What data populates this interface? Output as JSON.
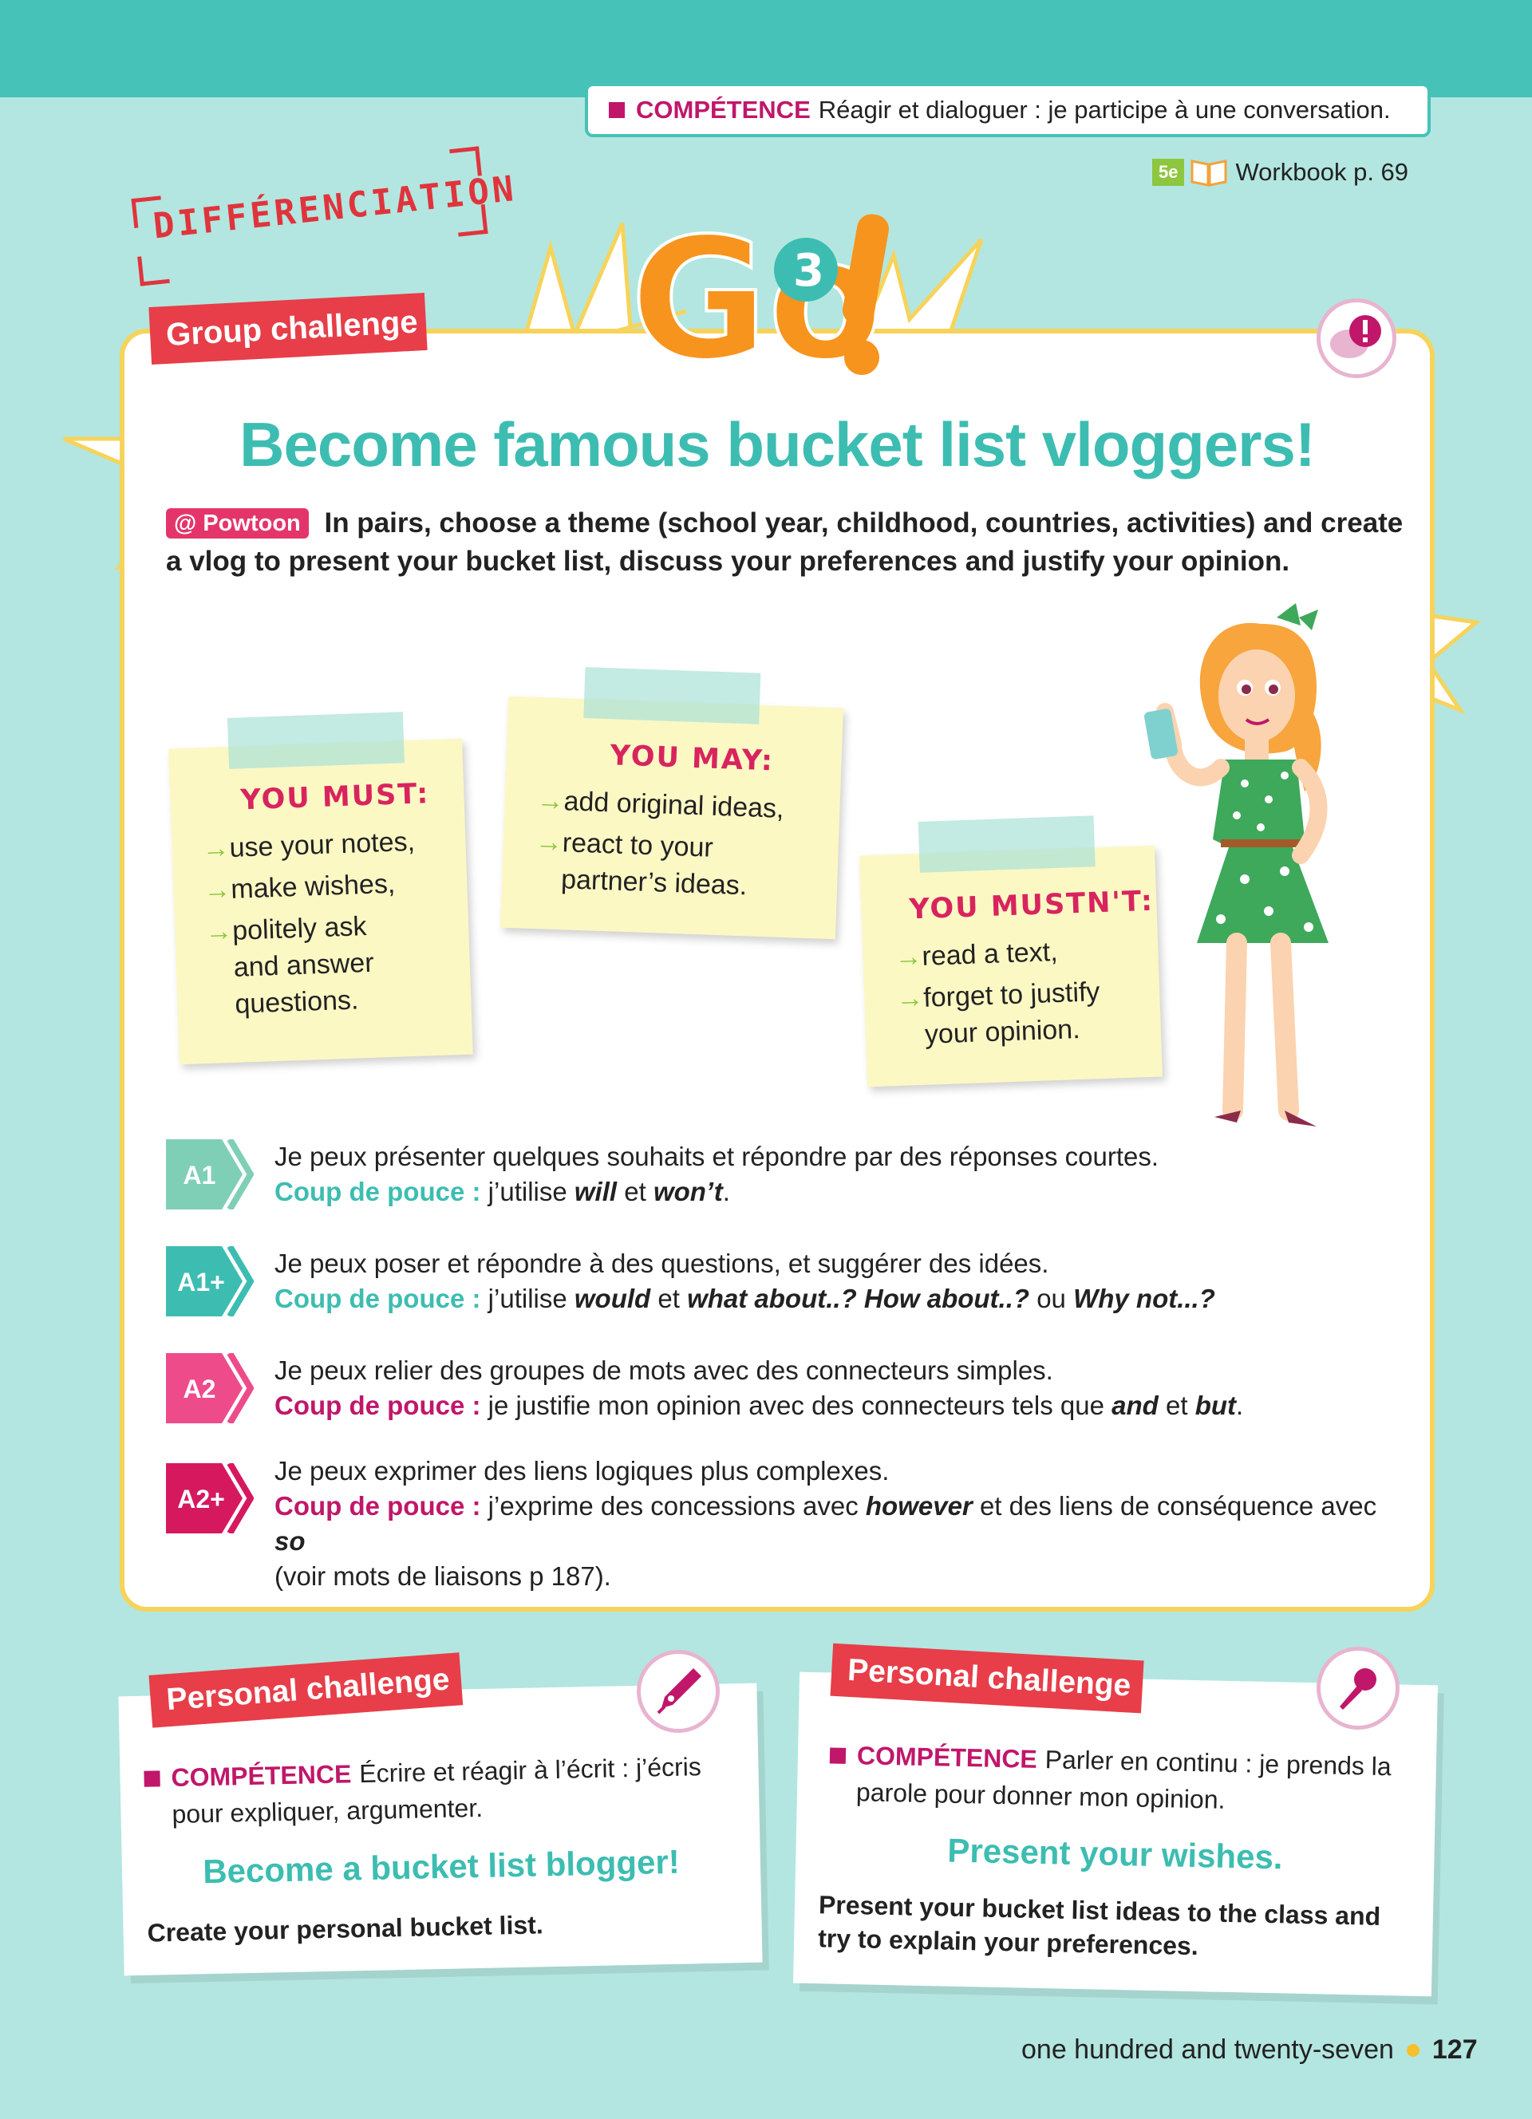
{
  "header": {
    "competence_label": "COMPÉTENCE",
    "competence_text": "Réagir et dialoguer : je participe à une conversation.",
    "level": "5e",
    "workbook": "Workbook p. 69"
  },
  "differenciation": "DIFFÉRENCIATION",
  "group_challenge": {
    "ribbon": "Group challenge",
    "logo_main": "Go",
    "logo_num": "3",
    "title": "Become famous bucket list vloggers!",
    "tool_tag": "@ Powtoon",
    "instructions": "In pairs, choose a theme (school year, childhood, countries, activities) and create a vlog to present your bucket list, discuss your preferences and justify your opinion.",
    "notes": {
      "must": {
        "title": "YOU MUST:",
        "items": [
          "use your notes,",
          "make wishes,",
          "politely ask",
          "and answer",
          "questions."
        ]
      },
      "may": {
        "title": "YOU MAY:",
        "items": [
          "add original ideas,",
          "react to your",
          "partner’s ideas."
        ]
      },
      "mustnt": {
        "title": "YOU MUSTN'T:",
        "items": [
          "read a text,",
          "forget to justify",
          "your opinion."
        ]
      }
    },
    "levels": [
      {
        "badge": "A1",
        "line1": "Je peux présenter quelques souhaits et répondre par des réponses courtes.",
        "cdp": "Coup de pouce :",
        "t1": "j’utilise",
        "b1": "will",
        "t2": "et",
        "b2": "won’t",
        "t3": "."
      },
      {
        "badge": "A1+",
        "line1": "Je peux poser et répondre à des questions, et suggérer des idées.",
        "cdp": "Coup de pouce :",
        "t1": "j’utilise",
        "b1": "would",
        "t2": "et",
        "b2": "what about..? How about..?",
        "t3": "ou",
        "b3": "Why not...?"
      },
      {
        "badge": "A2",
        "line1": "Je peux relier des groupes de mots avec des connecteurs simples.",
        "cdp": "Coup de pouce :",
        "t1": "je justifie mon opinion avec des connecteurs tels que",
        "b1": "and",
        "t2": "et",
        "b2": "but",
        "t3": "."
      },
      {
        "badge": "A2+",
        "line1": "Je peux exprimer des liens logiques plus complexes.",
        "cdp": "Coup de pouce :",
        "t1": "j’exprime des concessions avec",
        "b1": "however",
        "t2": "et des liens de conséquence avec",
        "b2": "so",
        "line3": "(voir mots de liaisons p 187)."
      }
    ]
  },
  "personal_left": {
    "ribbon": "Personal challenge",
    "competence_label": "COMPÉTENCE",
    "competence_line1": "Écrire et réagir à l’écrit : j’écris",
    "competence_line2": "pour expliquer, argumenter.",
    "title": "Become a bucket list blogger!",
    "text": "Create your personal bucket list."
  },
  "personal_right": {
    "ribbon": "Personal challenge",
    "competence_label": "COMPÉTENCE",
    "competence_line1": "Parler en continu : je prends la",
    "competence_line2": "parole pour donner mon opinion.",
    "title": "Present your wishes.",
    "text_line1": "Present your bucket list ideas to the class and",
    "text_line2": "try to explain your preferences."
  },
  "footer": {
    "text": "one hundred and twenty-seven",
    "page": "127"
  },
  "colors": {
    "teal": "#3dbdb1",
    "magenta": "#c0176a",
    "red_ribbon": "#e73e49",
    "yellow_border": "#f6d35a",
    "note": "#fbf8c4"
  }
}
